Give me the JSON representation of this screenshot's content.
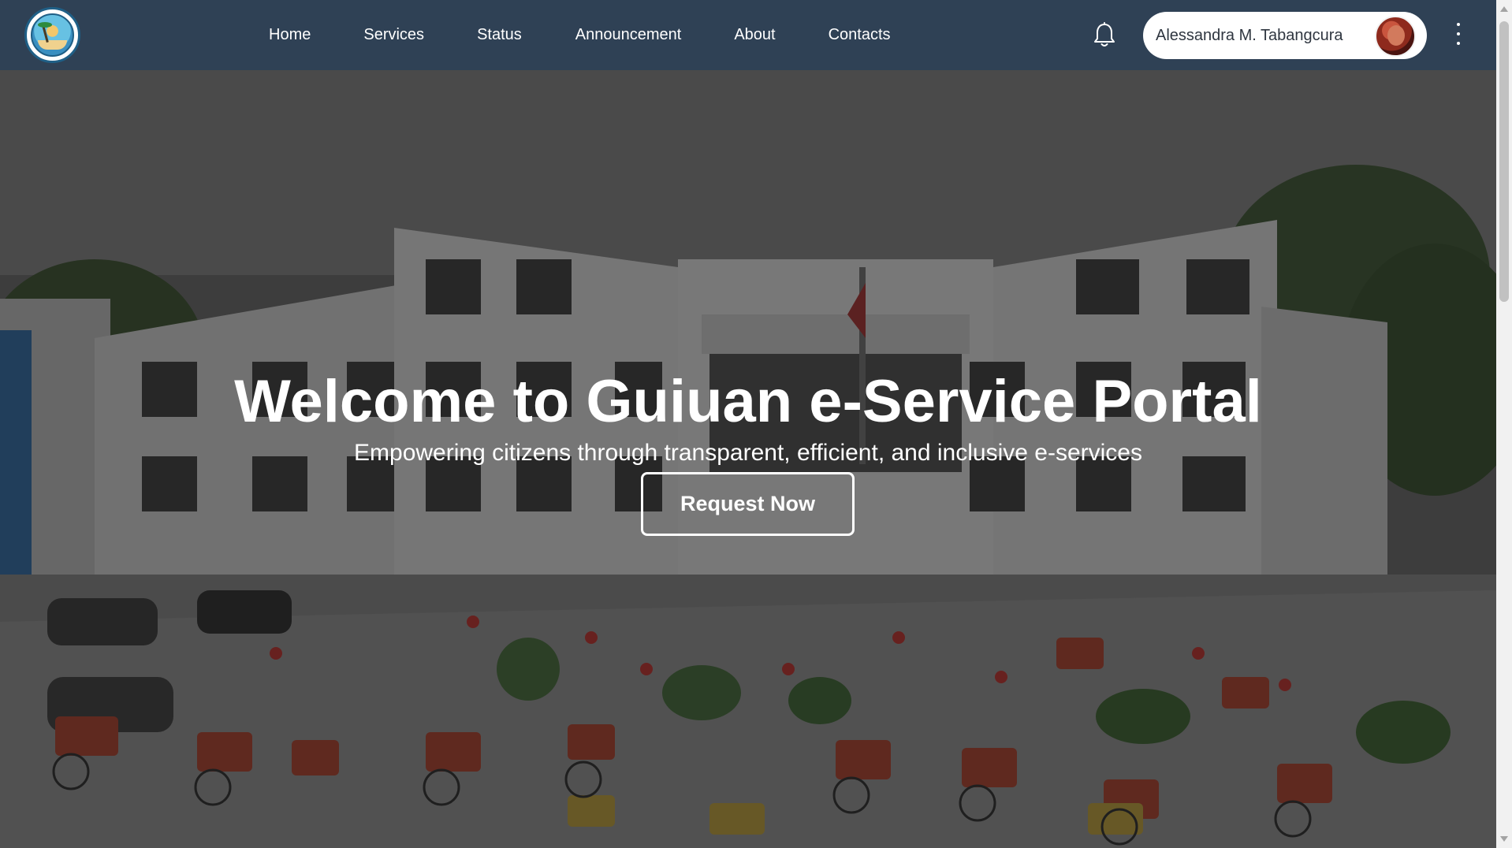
{
  "nav": {
    "items": [
      {
        "label": "Home"
      },
      {
        "label": "Services"
      },
      {
        "label": "Status"
      },
      {
        "label": "Announcement"
      },
      {
        "label": "About"
      },
      {
        "label": "Contacts"
      }
    ],
    "icons": {
      "logo": "municipal-seal-logo",
      "notifications": "bell-icon",
      "more": "vertical-dots-icon"
    }
  },
  "user": {
    "name": "Alessandra M. Tabangcura"
  },
  "hero": {
    "title": "Welcome to Guiuan e-Service Portal",
    "subtitle": "Empowering citizens through transparent, efficient, and inclusive e-services",
    "cta_label": "Request Now",
    "background": "municipal-hall-photo"
  },
  "colors": {
    "navbar": "#2f4155",
    "hero_overlay": "#161616",
    "text_light": "#ffffff"
  }
}
